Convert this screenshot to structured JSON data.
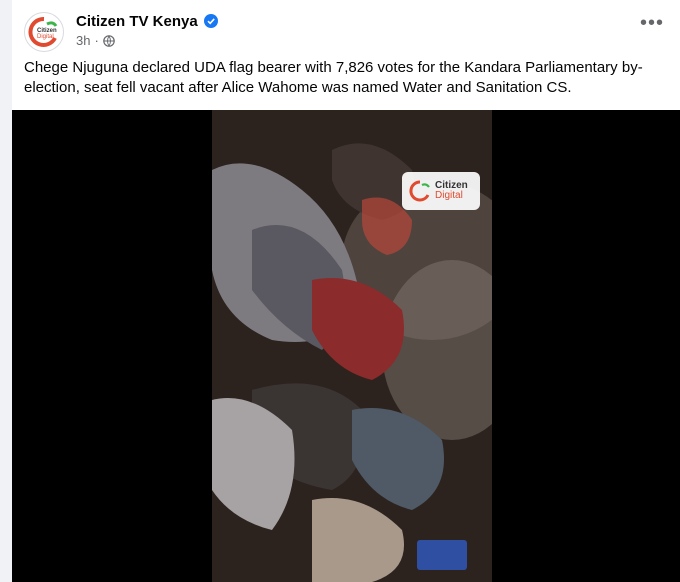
{
  "page": {
    "name": "Citizen TV Kenya",
    "time": "3h",
    "caption": "Chege Njuguna declared UDA flag bearer with 7,826 votes for the Kandara Parliamentary by-election, seat fell vacant after Alice Wahome was named Water and Sanitation CS.",
    "more_label": "•••"
  },
  "avatar": {
    "line1": "Citizen",
    "line2": "Digital"
  },
  "watermark": {
    "line1": "Citizen",
    "line2": "Digital"
  },
  "icons": {
    "verified": "verified-badge-icon",
    "audience": "globe-icon",
    "more": "more-options-icon",
    "logo": "citizen-digital-logo-icon"
  },
  "colors": {
    "verified": "#1877f2",
    "logo_orange": "#e04a2f",
    "logo_green": "#3db54a",
    "text_secondary": "#65676b"
  }
}
